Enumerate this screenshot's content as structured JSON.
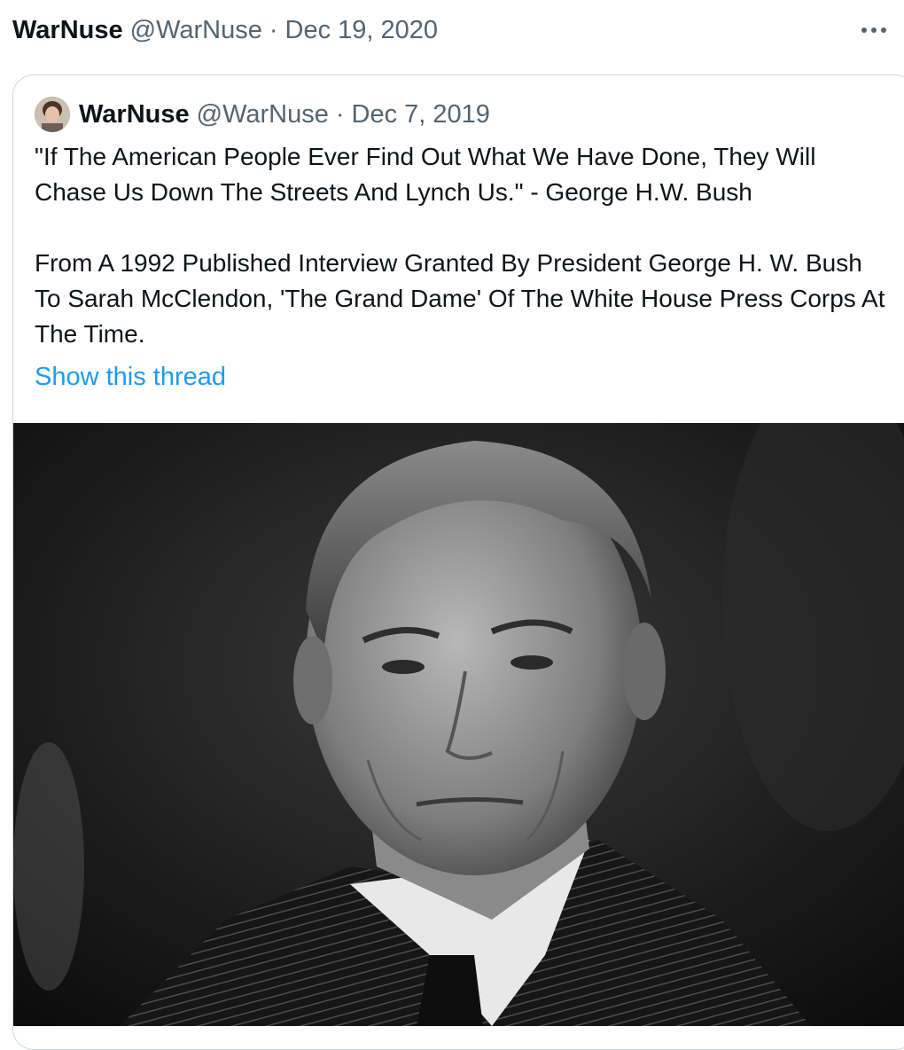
{
  "tweet": {
    "author_name": "WarNuse",
    "author_handle": "@WarNuse",
    "separator": "·",
    "date": "Dec 19, 2020",
    "more_icon": "more-horizontal-icon"
  },
  "quoted_tweet": {
    "author_name": "WarNuse",
    "author_handle": "@WarNuse",
    "separator": "·",
    "date": "Dec 7, 2019",
    "paragraphs": [
      "\"If The American People Ever Find Out What We Have Done, They Will Chase Us Down The Streets And Lynch Us.\" - George H.W. Bush",
      "From A 1992 Published Interview Granted By President George H. W. Bush To Sarah McClendon, 'The Grand Dame' Of The White House Press Corps At The Time."
    ],
    "show_thread_label": "Show this thread",
    "link_color": "#1d9bf0"
  },
  "colors": {
    "text_primary": "#0f1419",
    "text_secondary": "#536471",
    "border": "#cfd9de"
  }
}
